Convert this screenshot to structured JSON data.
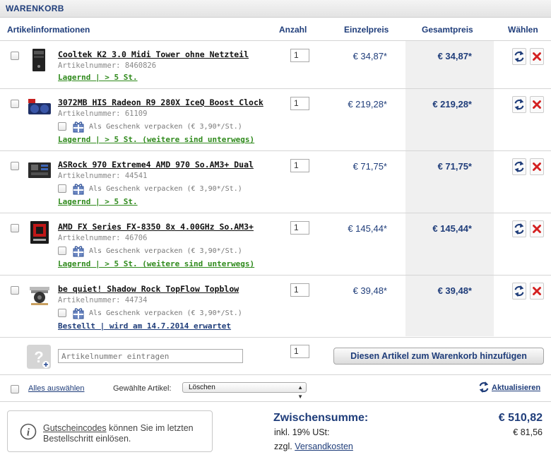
{
  "cart": {
    "title": "WARENKORB",
    "headers": {
      "article_info": "Artikelinformationen",
      "quantity": "Anzahl",
      "unit_price": "Einzelpreis",
      "total_price": "Gesamtpreis",
      "select": "Wählen"
    },
    "items": [
      {
        "name": "Cooltek K2 3.0 Midi Tower ohne Netzteil",
        "artnr": "Artikelnummer: 8460826",
        "stock": "Lagernd | > 5 St.",
        "quantity": "1",
        "unit_price": "€ 34,87*",
        "total_price": "€ 34,87*"
      },
      {
        "name": "3072MB HIS Radeon R9 280X IceQ Boost Clock",
        "artnr": "Artikelnummer: 61109",
        "gift": "Als Geschenk verpacken (€ 3,90*/St.)",
        "stock": "Lagernd | > 5 St. (weitere sind unterwegs)",
        "quantity": "1",
        "unit_price": "€ 219,28*",
        "total_price": "€ 219,28*"
      },
      {
        "name": "ASRock 970 Extreme4 AMD 970 So.AM3+ Dual",
        "artnr": "Artikelnummer: 44541",
        "gift": "Als Geschenk verpacken (€ 3,90*/St.)",
        "stock": "Lagernd | > 5 St.",
        "quantity": "1",
        "unit_price": "€ 71,75*",
        "total_price": "€ 71,75*"
      },
      {
        "name": "AMD FX Series FX-8350 8x 4.00GHz So.AM3+",
        "artnr": "Artikelnummer: 46706",
        "gift": "Als Geschenk verpacken (€ 3,90*/St.)",
        "stock": "Lagernd | > 5 St. (weitere sind unterwegs)",
        "quantity": "1",
        "unit_price": "€ 145,44*",
        "total_price": "€ 145,44*"
      },
      {
        "name": "be quiet! Shadow Rock TopFlow Topblow",
        "artnr": "Artikelnummer: 44734",
        "gift": "Als Geschenk verpacken (€ 3,90*/St.)",
        "stock": "Bestellt | wird am 14.7.2014 erwartet",
        "quantity": "1",
        "unit_price": "€ 39,48*",
        "total_price": "€ 39,48*"
      }
    ],
    "add_row": {
      "placeholder": "Artikelnummer eintragen",
      "quantity": "1",
      "button": "Diesen Artikel zum Warenkorb hinzufügen"
    },
    "toolbar": {
      "select_all": "Alles auswählen",
      "selected_label": "Gewählte Artikel:",
      "selected_action": "Löschen",
      "refresh": "Aktualisieren"
    },
    "voucher": {
      "link": "Gutscheincodes",
      "text": " können Sie im letzten Bestellschritt einlösen."
    },
    "summary": {
      "subtotal_label": "Zwischensumme:",
      "subtotal_value": "€ 510,82",
      "tax_label": "inkl. 19% USt:",
      "tax_value": "€ 81,56",
      "shipping_prefix": "zzgl. ",
      "shipping_link": "Versandkosten"
    },
    "colors": {
      "brand_blue": "#1f3d7a",
      "stock_green": "#2f8a1c",
      "delete_red": "#d42020"
    }
  }
}
